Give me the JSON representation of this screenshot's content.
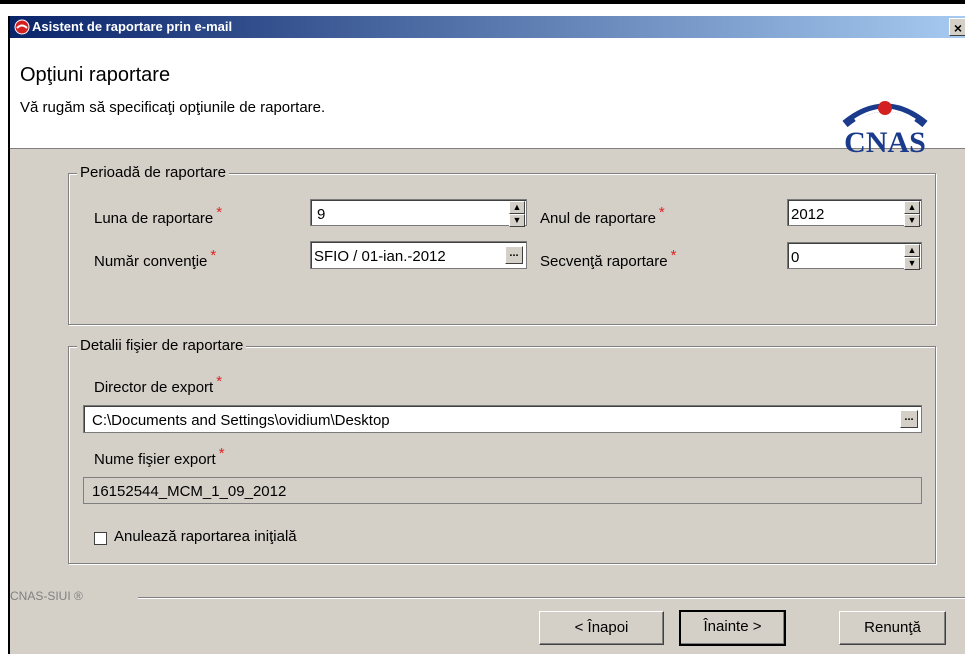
{
  "window": {
    "title": "Asistent de raportare prin e-mail",
    "close": "×"
  },
  "header": {
    "title": "Opţiuni raportare",
    "subtitle": "Vă rugăm să specificaţi opţiunile de raportare.",
    "logo_text": "CNAS"
  },
  "perioada": {
    "legend": "Perioadă de raportare",
    "luna_label": "Luna de raportare",
    "luna_value": "9",
    "anul_label": "Anul de raportare",
    "anul_value": "2012",
    "conventie_label": "Număr convenţie",
    "conventie_value": "SFIO / 01-ian.-2012",
    "secventa_label": "Secvenţă raportare",
    "secventa_value": "0",
    "required_mark": "*"
  },
  "fisier": {
    "legend": "Detalii fişier de raportare",
    "director_label": "Director de export",
    "director_value": "C:\\Documents and Settings\\ovidium\\Desktop",
    "nume_label": "Nume fişier export",
    "nume_value": "16152544_MCM_1_09_2012",
    "anuleaza_label": "Anulează raportarea iniţială",
    "anuleaza_checked": false
  },
  "footer": {
    "brand": "CNAS-SIUI ®",
    "back": "< Înapoi",
    "next": "Înainte >",
    "cancel": "Renunţă"
  },
  "icons": {
    "spin_up": "▲",
    "spin_down": "▼",
    "browse": "..."
  }
}
